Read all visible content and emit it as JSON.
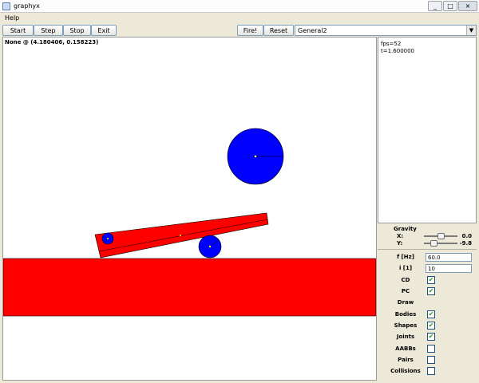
{
  "window": {
    "title": "graphyx",
    "buttons": {
      "minimize": "_",
      "maximize": "□",
      "close": "×"
    }
  },
  "menu": {
    "help": "Help"
  },
  "toolbar": {
    "start": "Start",
    "step": "Step",
    "stop": "Stop",
    "exit": "Exit",
    "fire": "Fire!",
    "reset": "Reset",
    "scene_select": "General2",
    "dropdown_arrow": "▼"
  },
  "canvas": {
    "readout": "None @ (4.180406, 0.158223)"
  },
  "stats": {
    "fps": "fps=52",
    "time": "t=1.600000"
  },
  "settings": {
    "gravity": {
      "title": "Gravity",
      "x_label": "X:",
      "x_value": "0.0",
      "x_position": 0.5,
      "y_label": "Y:",
      "y_value": "-9.8",
      "y_position": 0.25
    },
    "frequency": {
      "label": "f [Hz]",
      "value": "60.0"
    },
    "iterations": {
      "label": "i [1]",
      "value": "10"
    },
    "cd": {
      "label": "CD",
      "checked": true
    },
    "pc": {
      "label": "PC",
      "checked": true
    },
    "draw_label": "Draw",
    "bodies": {
      "label": "Bodies",
      "checked": true
    },
    "shapes": {
      "label": "Shapes",
      "checked": true
    },
    "joints": {
      "label": "Joints",
      "checked": true
    },
    "aabbs": {
      "label": "AABBs",
      "checked": false
    },
    "pairs": {
      "label": "Pairs",
      "checked": false
    },
    "collisions": {
      "label": "Collisions",
      "checked": false
    }
  },
  "colors": {
    "body": "#0000ff",
    "ground": "#ff0000",
    "plank": "#ff0000"
  },
  "check_glyph": "✔"
}
